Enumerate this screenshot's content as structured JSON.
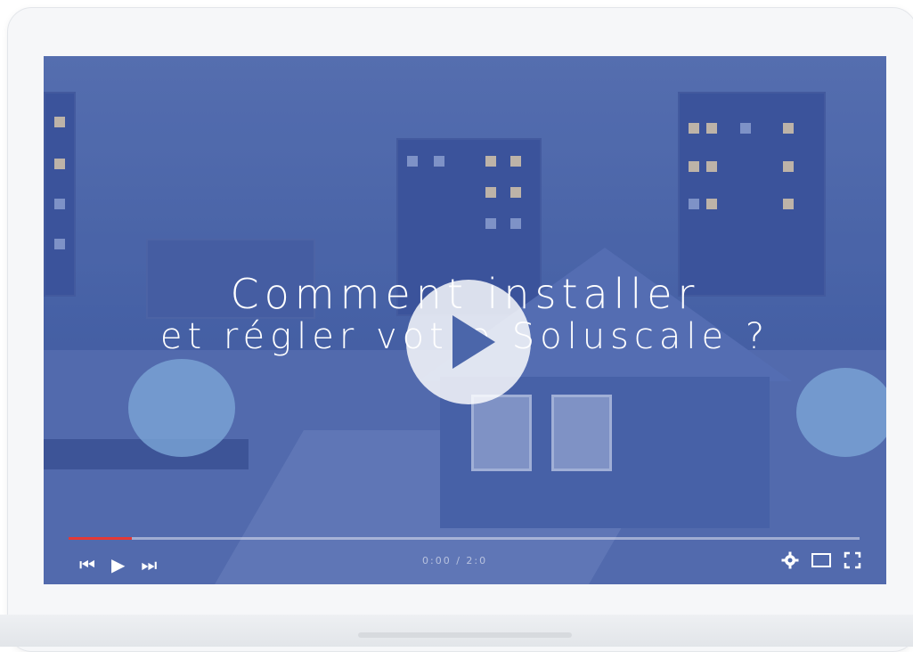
{
  "video": {
    "title_line1": "Comment installer",
    "title_line2": "et régler votre Soluscale ?",
    "timecode": "0:00 / 2:0",
    "progress_fraction": 0.08
  },
  "controls": {
    "previous_icon": "⏮",
    "play_icon": "▶",
    "next_icon": "⏭",
    "settings_icon": "gear-icon",
    "miniplayer_icon": "miniplayer-icon",
    "fullscreen_icon": "fullscreen-icon"
  },
  "colors": {
    "progress": "#e53935",
    "overlay": "#4a66ab"
  }
}
